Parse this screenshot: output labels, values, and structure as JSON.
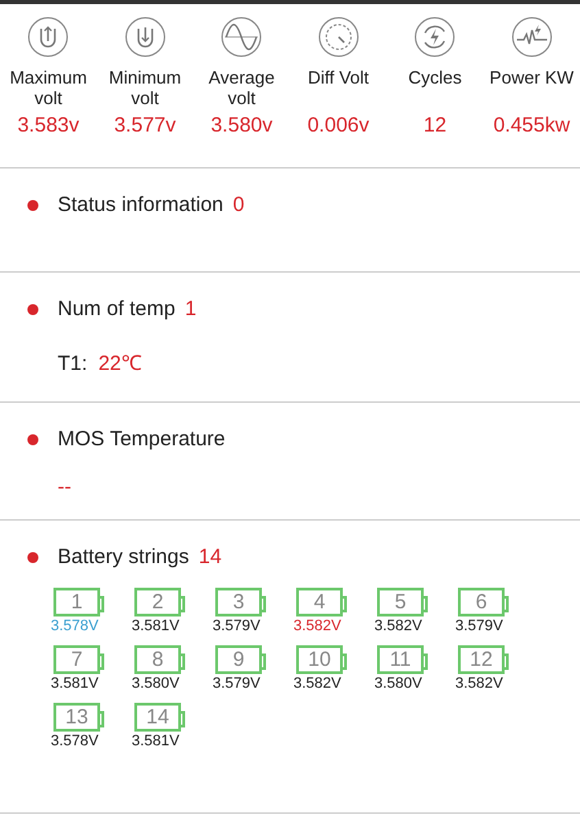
{
  "stats": [
    {
      "kind": "max",
      "label": "Maximum volt",
      "value": "3.583v"
    },
    {
      "kind": "min",
      "label": "Minimum volt",
      "value": "3.577v"
    },
    {
      "kind": "avg",
      "label": "Average volt",
      "value": "3.580v"
    },
    {
      "kind": "diff",
      "label": "Diff Volt",
      "value": "0.006v"
    },
    {
      "kind": "cycles",
      "label": "Cycles",
      "value": "12"
    },
    {
      "kind": "power",
      "label": "Power KW",
      "value": "0.455kw"
    }
  ],
  "status_information": {
    "title": "Status information",
    "count": "0"
  },
  "num_of_temp": {
    "title": "Num of temp",
    "count": "1",
    "sensors": [
      {
        "label": "T1:",
        "value": "22℃"
      }
    ]
  },
  "mos_temperature": {
    "title": "MOS Temperature",
    "value": "--"
  },
  "battery_strings": {
    "title": "Battery strings",
    "count": "14",
    "cells": [
      {
        "number": "1",
        "voltage": "3.578V",
        "color": "#3a9fd0"
      },
      {
        "number": "2",
        "voltage": "3.581V",
        "color": "#222222"
      },
      {
        "number": "3",
        "voltage": "3.579V",
        "color": "#222222"
      },
      {
        "number": "4",
        "voltage": "3.582V",
        "color": "#d8262c"
      },
      {
        "number": "5",
        "voltage": "3.582V",
        "color": "#222222"
      },
      {
        "number": "6",
        "voltage": "3.579V",
        "color": "#222222"
      },
      {
        "number": "7",
        "voltage": "3.581V",
        "color": "#222222"
      },
      {
        "number": "8",
        "voltage": "3.580V",
        "color": "#222222"
      },
      {
        "number": "9",
        "voltage": "3.579V",
        "color": "#222222"
      },
      {
        "number": "10",
        "voltage": "3.582V",
        "color": "#222222"
      },
      {
        "number": "11",
        "voltage": "3.580V",
        "color": "#222222"
      },
      {
        "number": "12",
        "voltage": "3.582V",
        "color": "#222222"
      },
      {
        "number": "13",
        "voltage": "3.578V",
        "color": "#222222"
      },
      {
        "number": "14",
        "voltage": "3.581V",
        "color": "#222222"
      }
    ]
  }
}
